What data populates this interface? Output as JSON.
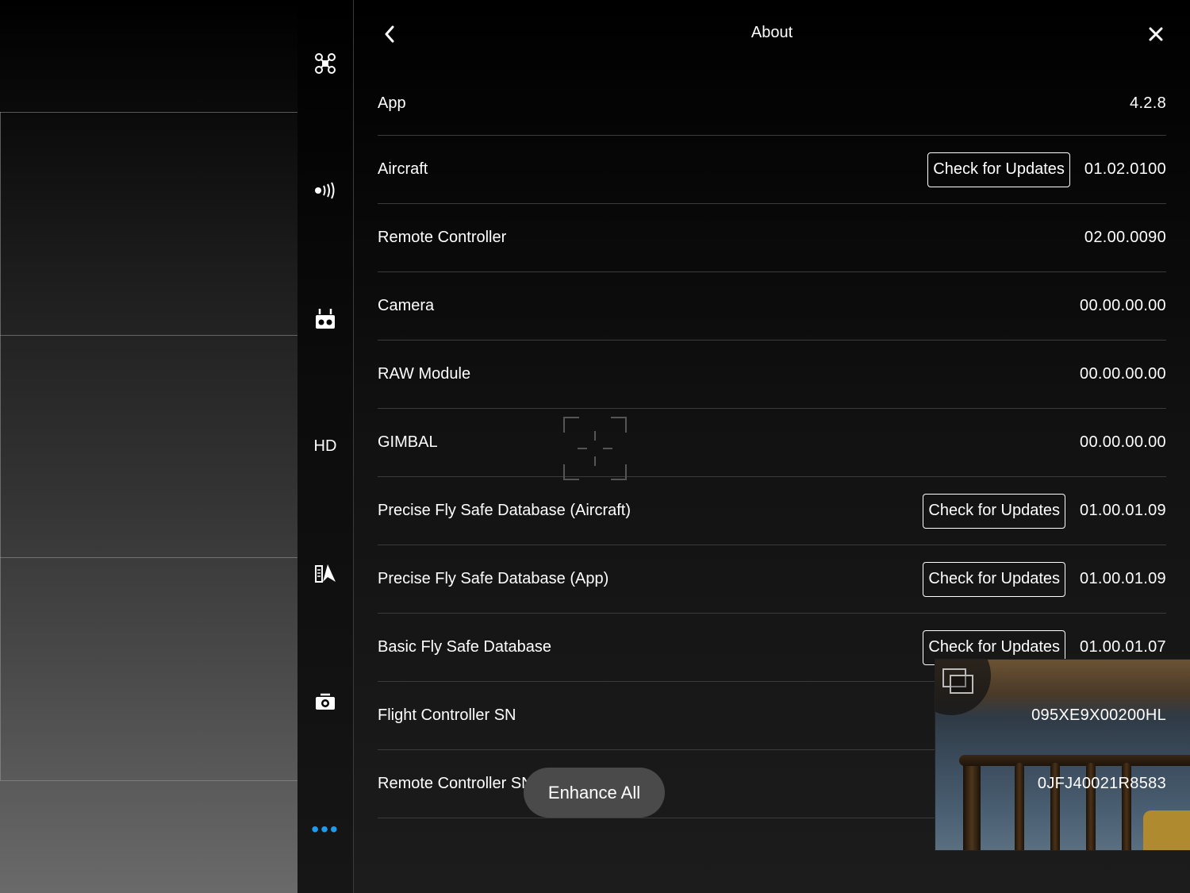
{
  "header": {
    "title": "About",
    "back_icon": "chevron-left-icon",
    "close_icon": "close-icon"
  },
  "sidebar": {
    "items": [
      {
        "name": "aircraft-settings",
        "icon": "drone-icon"
      },
      {
        "name": "signal-settings",
        "icon": "wireless-signal-icon"
      },
      {
        "name": "remote-controller-settings",
        "icon": "remote-controller-icon"
      },
      {
        "name": "hd-transmission",
        "label": "HD"
      },
      {
        "name": "map-navigation",
        "icon": "map-pin-icon"
      },
      {
        "name": "camera-settings",
        "icon": "camera-icon"
      },
      {
        "name": "more",
        "icon": "more-dots-icon",
        "label": "•••"
      }
    ],
    "more_color": "#1d9bf0"
  },
  "about": {
    "rows": [
      {
        "label": "App",
        "value": "4.2.8"
      },
      {
        "label": "Aircraft",
        "value": "01.02.0100",
        "button": "Check for Updates"
      },
      {
        "label": "Remote Controller",
        "value": "02.00.0090"
      },
      {
        "label": "Camera",
        "value": "00.00.00.00"
      },
      {
        "label": "RAW Module",
        "value": "00.00.00.00"
      },
      {
        "label": "GIMBAL",
        "value": "00.00.00.00"
      },
      {
        "label": "Precise Fly Safe Database (Aircraft)",
        "value": "01.00.01.09",
        "button": "Check for Updates"
      },
      {
        "label": "Precise Fly Safe Database (App)",
        "value": "01.00.01.09",
        "button": "Check for Updates"
      },
      {
        "label": "Basic Fly Safe Database",
        "value": "01.00.01.07",
        "button": "Check for Updates"
      },
      {
        "label": "Flight Controller SN",
        "value": "095XE9X00200HL"
      },
      {
        "label": "Remote Controller SN",
        "value": "0JFJ40021R8583"
      }
    ]
  },
  "overlay": {
    "enhance_label": "Enhance All",
    "thumbnail_icon": "gallery-icon"
  }
}
